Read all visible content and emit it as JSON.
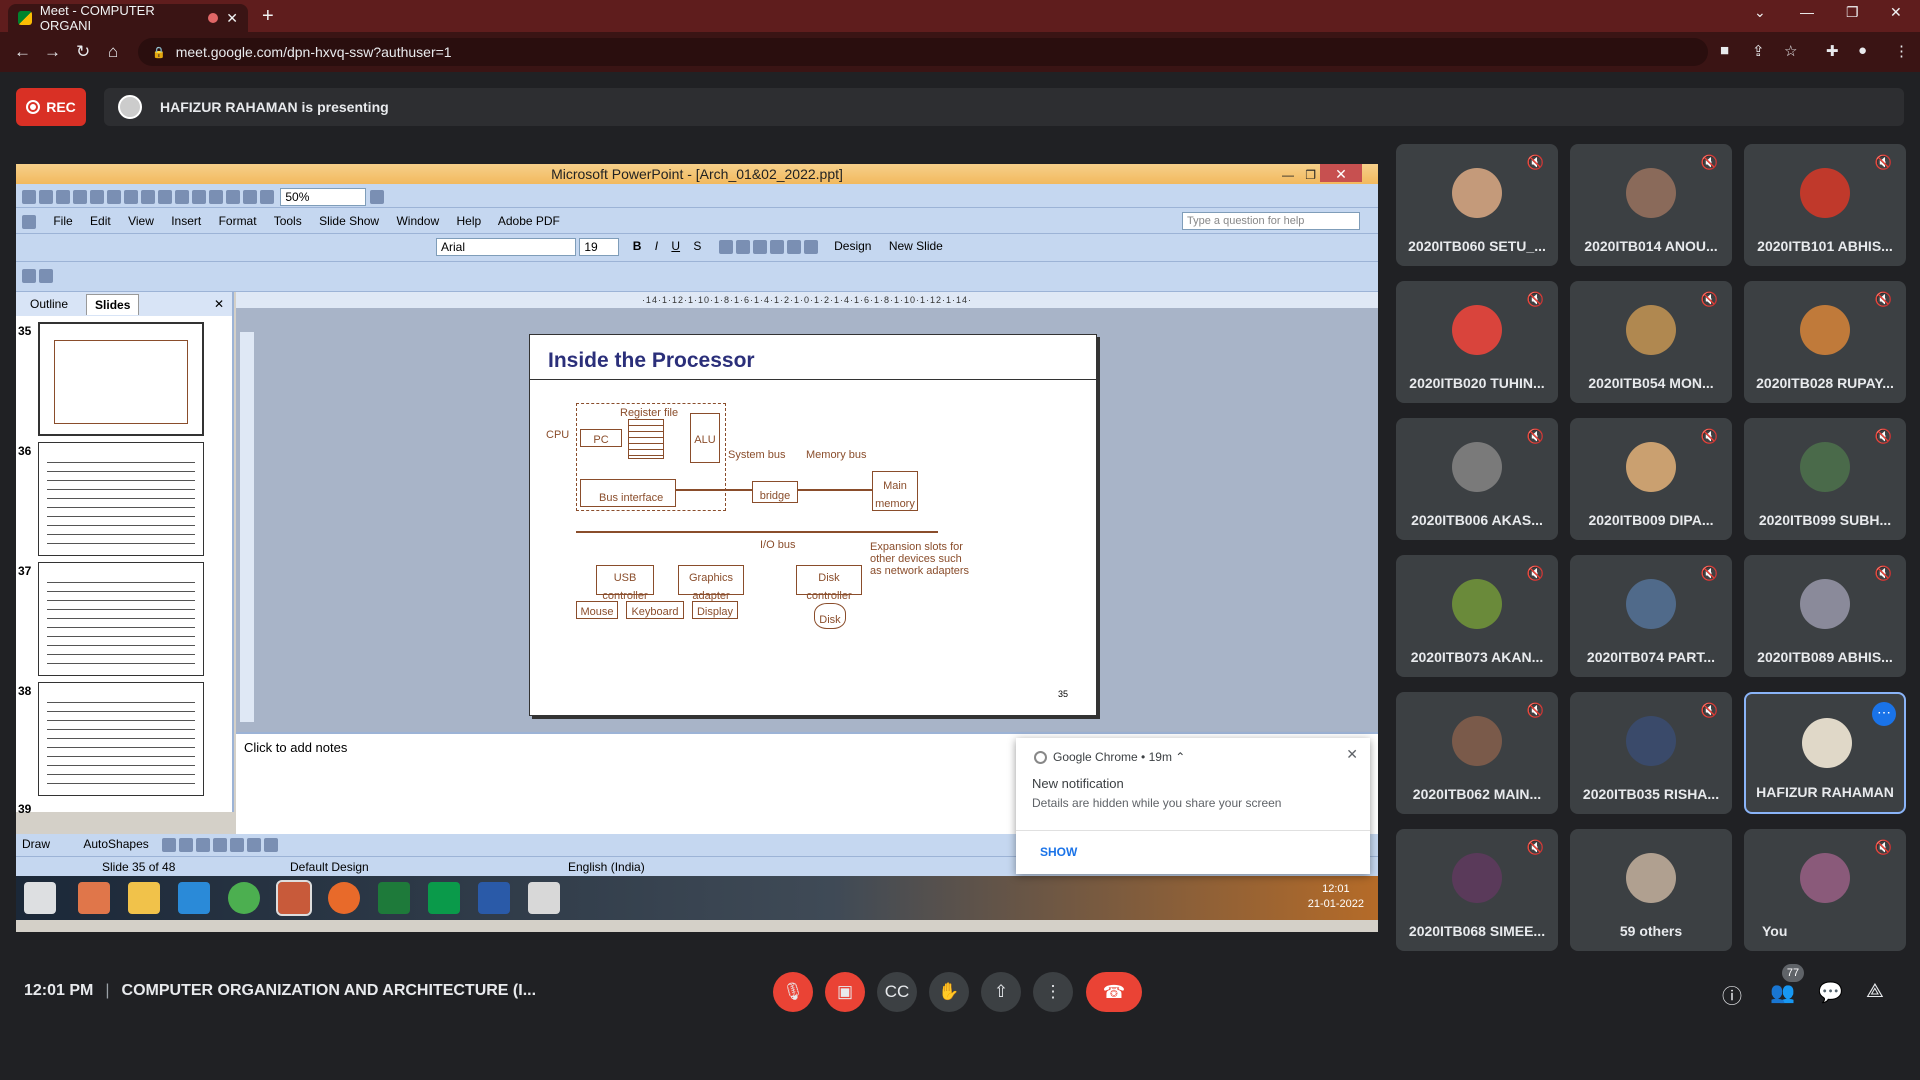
{
  "browser": {
    "tab_title": "Meet - COMPUTER ORGANI",
    "url": "meet.google.com/dpn-hxvq-ssw?authuser=1"
  },
  "meet": {
    "rec_label": "REC",
    "presenting_text": "HAFIZUR RAHAMAN is presenting"
  },
  "ppt": {
    "window_title": "Microsoft PowerPoint - [Arch_01&02_2022.ppt]",
    "menu": [
      "File",
      "Edit",
      "View",
      "Insert",
      "Format",
      "Tools",
      "Slide Show",
      "Window",
      "Help",
      "Adobe PDF"
    ],
    "zoom": "50%",
    "help_placeholder": "Type a question for help",
    "font": "Arial",
    "font_size": "19",
    "format_bold": "B",
    "format_italic": "I",
    "format_underline": "U",
    "format_shadow": "S",
    "design_label": "Design",
    "new_slide_label": "New Slide",
    "tab_outline": "Outline",
    "tab_slides": "Slides",
    "thumbs": [
      {
        "num": "35"
      },
      {
        "num": "36"
      },
      {
        "num": "37"
      },
      {
        "num": "38"
      },
      {
        "num": "39"
      }
    ],
    "ruler": "·14·1·12·1·10·1·8·1·6·1·4·1·2·1·0·1·2·1·4·1·6·1·8·1·10·1·12·1·14·",
    "slide": {
      "title": "Inside the Processor",
      "labels": {
        "cpu": "CPU",
        "register_file": "Register file",
        "pc": "PC",
        "alu": "ALU",
        "system_bus": "System bus",
        "memory_bus": "Memory bus",
        "bus_interface": "Bus interface",
        "bridge": "bridge",
        "main_memory": "Main memory",
        "io_bus": "I/O bus",
        "usb": "USB controller",
        "graphics": "Graphics adapter",
        "disk_ctrl": "Disk controller",
        "expansion": "Expansion slots for other devices such as network adapters",
        "mouse": "Mouse",
        "keyboard": "Keyboard",
        "display": "Display",
        "disk": "Disk",
        "page": "35"
      }
    },
    "notes_placeholder": "Click to add notes",
    "draw_label": "Draw",
    "autoshapes_label": "AutoShapes",
    "status": {
      "slide": "Slide 35 of 48",
      "design": "Default Design",
      "language": "English (India)"
    },
    "clock_time": "12:01",
    "clock_date": "21-01-2022"
  },
  "notification": {
    "source": "Google Chrome",
    "age": "19m",
    "title": "New notification",
    "detail": "Details are hidden while you share your screen",
    "action": "SHOW"
  },
  "participants": [
    {
      "name": "2020ITB060 SETU_...",
      "color": "#c49a7a"
    },
    {
      "name": "2020ITB014 ANOU...",
      "color": "#8a6a5a"
    },
    {
      "name": "2020ITB101 ABHIS...",
      "color": "#c0392b"
    },
    {
      "name": "2020ITB020 TUHIN...",
      "color": "#d9443c"
    },
    {
      "name": "2020ITB054 MON...",
      "color": "#b08850"
    },
    {
      "name": "2020ITB028 RUPAY...",
      "color": "#c07a3a"
    },
    {
      "name": "2020ITB006 AKAS...",
      "color": "#7a7a7a"
    },
    {
      "name": "2020ITB009 DIPA...",
      "color": "#caa070"
    },
    {
      "name": "2020ITB099 SUBH...",
      "color": "#4a6a4a"
    },
    {
      "name": "2020ITB073 AKAN...",
      "color": "#6a8a3a"
    },
    {
      "name": "2020ITB074 PART...",
      "color": "#506a8a"
    },
    {
      "name": "2020ITB089 ABHIS...",
      "color": "#8a8a9a"
    },
    {
      "name": "2020ITB062 MAIN...",
      "color": "#7a5a4a"
    },
    {
      "name": "2020ITB035 RISHA...",
      "color": "#3a4a6a"
    },
    {
      "name": "HAFIZUR RAHAMAN",
      "color": "#e0d8c8"
    },
    {
      "name": "2020ITB068 SIMEE...",
      "color": "#5a3a5a"
    },
    {
      "name": "59 others",
      "color": "#b0a090"
    },
    {
      "name": "You",
      "color": "#8a5a7a"
    }
  ],
  "bottom": {
    "time": "12:01 PM",
    "meeting_title": "COMPUTER ORGANIZATION AND ARCHITECTURE (I...",
    "people_count": "77"
  }
}
